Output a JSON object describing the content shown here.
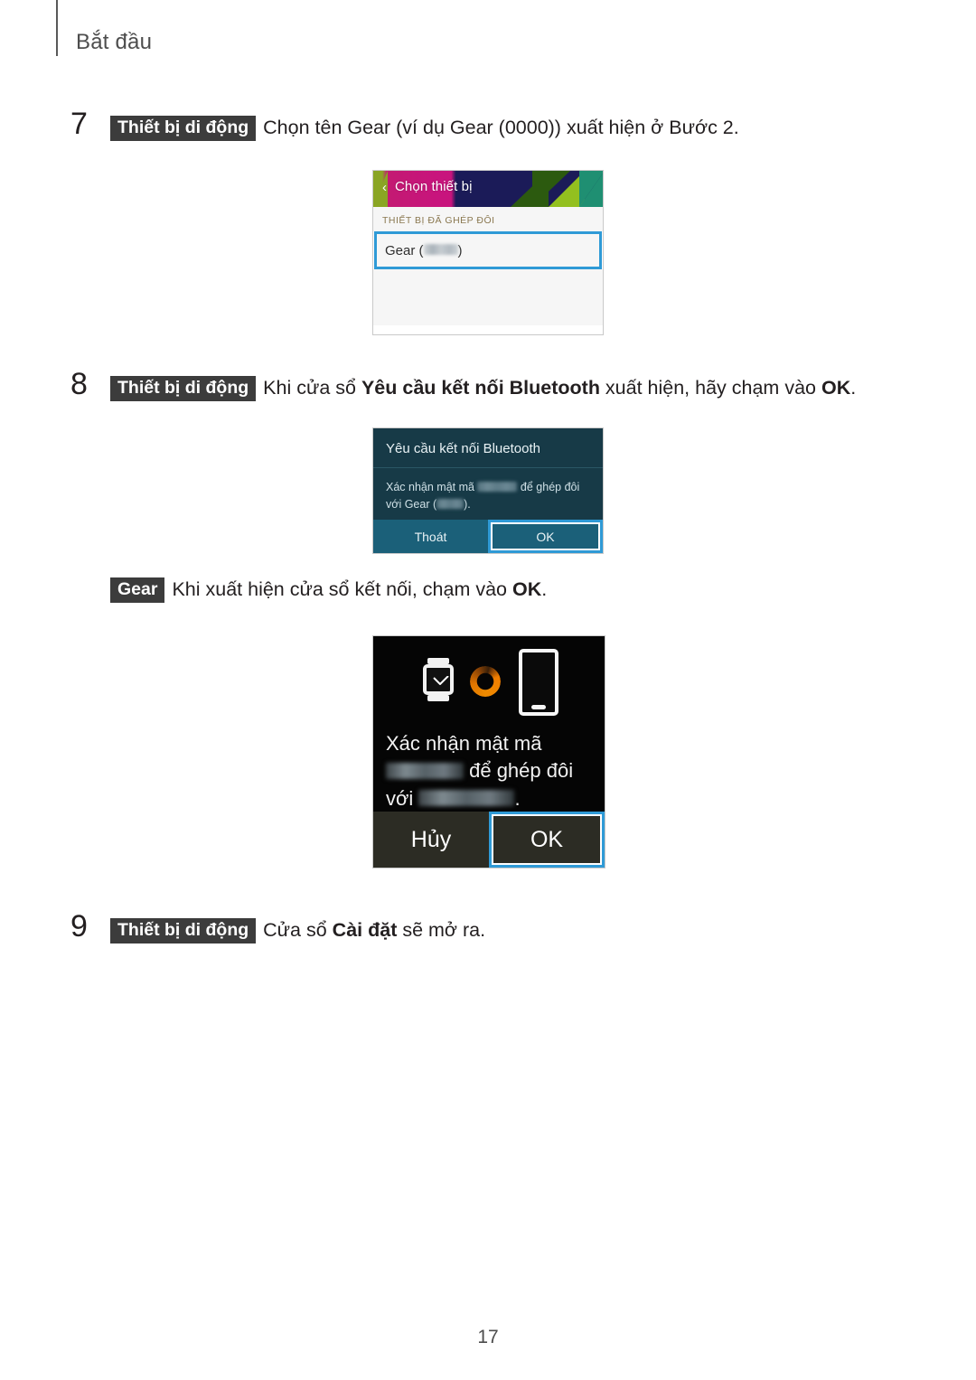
{
  "page": {
    "chapter_title": "Bắt đầu",
    "page_number": "17"
  },
  "steps": [
    {
      "number": "7",
      "tag": "Thiết bị di động",
      "text_before": "Chọn tên Gear (ví dụ Gear (0000)) xuất hiện ở Bước 2.",
      "text_bold": "",
      "text_after": ""
    },
    {
      "number": "8",
      "tag": "Thiết bị di động",
      "text_before": "Khi cửa sổ ",
      "text_bold": "Yêu cầu kết nối Bluetooth",
      "text_mid": " xuất hiện, hãy chạm vào ",
      "text_bold2": "OK",
      "text_after": "."
    },
    {
      "number": "9",
      "tag": "Thiết bị di động",
      "text_before": "Cửa sổ ",
      "text_bold": "Cài đặt",
      "text_after": " sẽ mở ra."
    }
  ],
  "sub_step": {
    "tag": "Gear",
    "text_before": "Khi xuất hiện cửa sổ kết nối, chạm vào ",
    "text_bold": "OK",
    "text_after": "."
  },
  "screenshot_device_picker": {
    "back_icon": "chevron-left-icon",
    "title": "Chọn thiết bị",
    "section_label": "THIẾT BỊ ĐÃ GHÉP ĐÔI",
    "row_prefix": "Gear (",
    "row_suffix": ")",
    "row_redacted": true,
    "highlight_color": "#2f9ad6"
  },
  "screenshot_bluetooth_dialog": {
    "title": "Yêu cầu kết nối Bluetooth",
    "body_part1": "Xác nhận mật mã ",
    "body_part2": " để ghép đôi",
    "body_part3": "với Gear (",
    "body_part4": ").",
    "button_cancel": "Thoát",
    "button_ok": "OK",
    "selected_button": "OK",
    "background_color": "#173a47",
    "button_color": "#1b6079",
    "highlight_color": "#2f9ad6"
  },
  "screenshot_gear_confirm": {
    "icons": [
      "watch-icon",
      "sync-ring-icon",
      "phone-icon"
    ],
    "text_line1": "Xác nhận mật mã",
    "text_line2_suffix": " để ghép đôi",
    "text_line3_prefix": "với",
    "text_line3_suffix": ".",
    "button_cancel": "Hủy",
    "button_ok": "OK",
    "selected_button": "OK",
    "background_color": "#050505",
    "button_color": "#2c2c24",
    "ring_color": "#f07d00",
    "highlight_color": "#2f9ad6"
  }
}
